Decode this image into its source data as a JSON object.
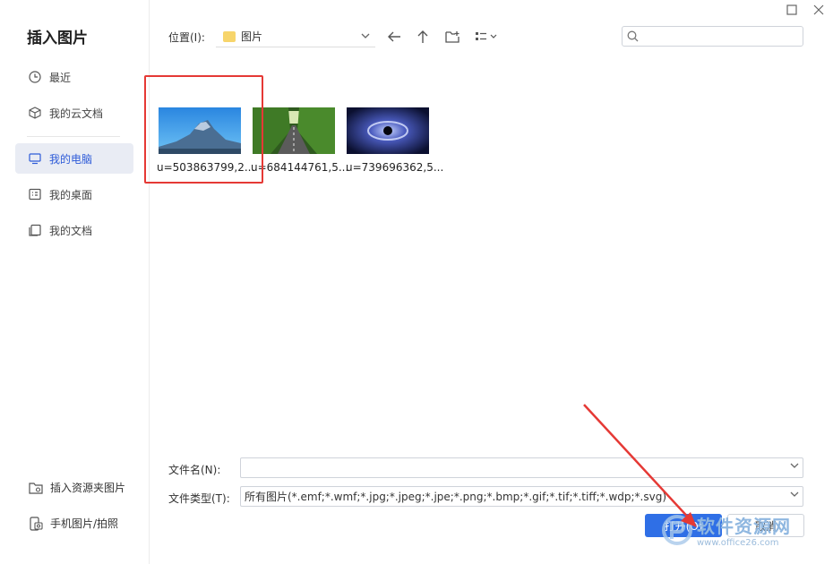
{
  "dialog": {
    "title": "插入图片"
  },
  "sidebar": {
    "items": [
      {
        "label": "最近",
        "icon": "clock-icon"
      },
      {
        "label": "我的云文档",
        "icon": "cloud-box-icon"
      },
      {
        "label": "我的电脑",
        "icon": "monitor-icon"
      },
      {
        "label": "我的桌面",
        "icon": "desktop-icon"
      },
      {
        "label": "我的文档",
        "icon": "document-icon"
      }
    ],
    "active_index": 2,
    "bottom_items": [
      {
        "label": "插入资源夹图片",
        "icon": "folder-image-icon"
      },
      {
        "label": "手机图片/拍照",
        "icon": "phone-photo-icon"
      }
    ]
  },
  "toolbar": {
    "location_label": "位置(I):",
    "location_value": "图片",
    "search_placeholder": ""
  },
  "files": [
    {
      "name": "u=503863799,2...",
      "thumb": "mountain-blue-sky"
    },
    {
      "name": "u=684144761,5...",
      "thumb": "tree-lined-road"
    },
    {
      "name": "u=739696362,5...",
      "thumb": "cosmic-eye"
    }
  ],
  "form": {
    "filename_label": "文件名(N):",
    "filename_value": "",
    "filetype_label": "文件类型(T):",
    "filetype_value": "所有图片(*.emf;*.wmf;*.jpg;*.jpeg;*.jpe;*.png;*.bmp;*.gif;*.tif;*.tiff;*.wdp;*.svg)"
  },
  "buttons": {
    "open_label": "打开(O)",
    "cancel_label": "取消"
  },
  "watermark": {
    "text": "软件资源网",
    "url": "www.office26.com"
  },
  "colors": {
    "accent": "#2f6fe6",
    "annotation": "#e53935",
    "active_nav_bg": "#e9ecf4"
  }
}
